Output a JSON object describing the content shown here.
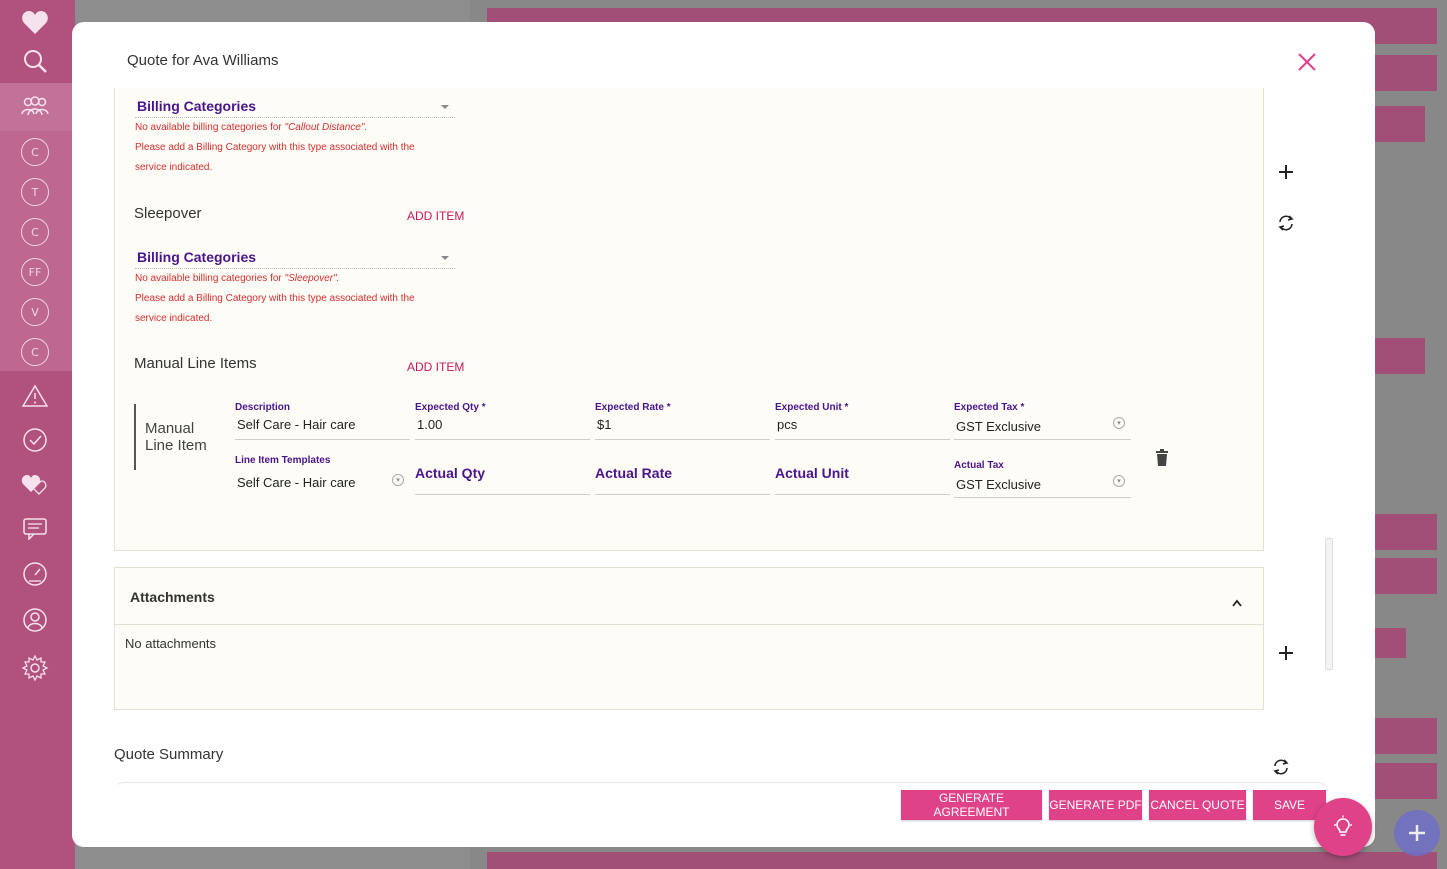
{
  "modal": {
    "title": "Quote for Ava Williams"
  },
  "sections": {
    "callout": {
      "billing_label": "Billing Categories",
      "error_prefix": "No available billing categories for ",
      "error_type": "\"Callout Distance\".",
      "error_line2": "Please add a Billing Category with this type associated with the",
      "error_line3": "service indicated."
    },
    "sleepover": {
      "title": "Sleepover",
      "add_label": "ADD ITEM",
      "billing_label": "Billing Categories",
      "error_prefix": "No available billing categories for ",
      "error_type": "\"Sleepover\".",
      "error_line2": "Please add a Billing Category with this type associated with the",
      "error_line3": "service indicated."
    },
    "manual": {
      "title": "Manual Line Items",
      "add_label": "ADD ITEM",
      "item": {
        "name_line1": "Manual",
        "name_line2": "Line Item",
        "description_label": "Description",
        "description_value": "Self Care - Hair care",
        "expected_qty_label": "Expected Qty",
        "expected_qty_value": "1.00",
        "expected_rate_label": "Expected Rate",
        "expected_rate_value": "$1",
        "expected_unit_label": "Expected Unit",
        "expected_unit_value": "pcs",
        "expected_tax_label": "Expected Tax",
        "expected_tax_value": "GST Exclusive",
        "template_label": "Line Item Templates",
        "template_value": "Self Care - Hair care",
        "actual_qty_label": "Actual Qty",
        "actual_rate_label": "Actual Rate",
        "actual_unit_label": "Actual Unit",
        "actual_tax_label": "Actual Tax",
        "actual_tax_value": "GST Exclusive",
        "required_mark": "*"
      }
    }
  },
  "attachments": {
    "title": "Attachments",
    "empty_text": "No attachments"
  },
  "quote_summary": {
    "title": "Quote Summary"
  },
  "actions": {
    "generate_agreement": "GENERATE AGREEMENT",
    "generate_pdf": "GENERATE PDF",
    "cancel_quote": "CANCEL QUOTE",
    "save": "SAVE"
  },
  "rail": {
    "badges": [
      "C",
      "T",
      "C",
      "FF",
      "V",
      "C"
    ]
  },
  "colors": {
    "accent": "#e0428a",
    "label_purple": "#4a148c",
    "error_red": "#d32f2f",
    "rail": "#b0517e"
  }
}
